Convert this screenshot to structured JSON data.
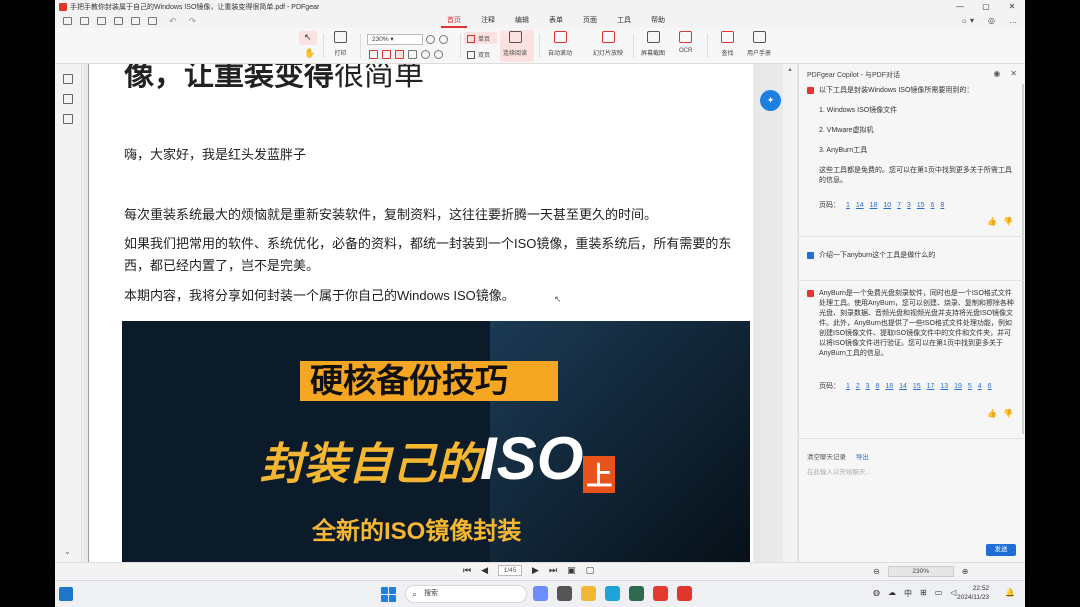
{
  "window": {
    "title": "手把手教你封装属于自己的Windows ISO镜像，让重装变得很简单.pdf - PDFgear",
    "controls": [
      "—",
      "▢",
      "✕"
    ]
  },
  "menu_tabs": [
    "首页",
    "注释",
    "编辑",
    "表单",
    "页面",
    "工具",
    "帮助"
  ],
  "active_menu_tab": "首页",
  "ribbon": {
    "print": "打印",
    "zoom_value": "230%",
    "single_page": "单页",
    "double_page": "双页",
    "continuous": "连续阅读",
    "auto_scroll": "自动滚动",
    "slideshow": "幻灯片放映",
    "screenshot": "屏幕截图",
    "ocr": "OCR",
    "find": "查找",
    "manual": "用户手册"
  },
  "document": {
    "heading_bold": "像，让重装变得",
    "heading_light": "很简单",
    "paragraphs": [
      "嗨，大家好，我是红头发蓝胖子",
      "每次重装系统最大的烦恼就是重新安装软件，复制资料，这往往要折腾一天甚至更久的时间。",
      "如果我们把常用的软件、系统优化，必备的资料，都统一封装到一个ISO镜像，重装系统后，所有需要的东西，都已经内置了，岂不是完美。",
      "本期内容，我将分享如何封装一个属于你自己的Windows ISO镜像。"
    ],
    "banner": {
      "line1": "硬核备份技巧",
      "line2_prefix": "封装自己的",
      "line2_iso": "ISO",
      "line2_badge": "上",
      "line3": "全新的ISO镜像封装"
    }
  },
  "copilot": {
    "header": "PDFgear Copilot - 与PDF对话",
    "answer1": {
      "intro": "以下工具是封装Windows ISO镜像所需要用到的：",
      "items": [
        "1. Windows ISO镜像文件",
        "2. VMware虚拟机",
        "3. AnyBurn工具"
      ],
      "note": "这些工具都是免费的。您可以在第1页中找到更多关于所需工具的信息。",
      "pages_label": "页码：",
      "pages": [
        "1",
        "14",
        "18",
        "10",
        "7",
        "3",
        "15",
        "6",
        "8"
      ]
    },
    "question": "介绍一下anyburn这个工具是做什么的",
    "answer2": {
      "text": "AnyBurn是一个免费光盘刻录软件，同时也是一个ISO格式文件处理工具。使用AnyBurn，您可以创建、烧录、复制和擦除各种光盘、刻录数据、音频光盘和视频光盘并支持将光盘ISO镜像文件。此外，AnyBurn也提供了一些ISO格式文件处理功能，例如创建ISO镜像文件、提取ISO镜像文件中的文件和文件夹，并可以将ISO镜像文件进行验证。您可以在第1页中找到更多关于AnyBurn工具的信息。",
      "pages_label": "页码：",
      "pages": [
        "1",
        "2",
        "3",
        "8",
        "18",
        "14",
        "15",
        "17",
        "13",
        "19",
        "5",
        "4",
        "6"
      ]
    },
    "clear_history": "清空聊天记录",
    "export": "导出",
    "input_placeholder": "在此输入以开始聊天...",
    "send": "发送"
  },
  "statusbar": {
    "page_indicator": "1/45",
    "zoom": "230%"
  },
  "taskbar": {
    "search_label": "搜索",
    "ime": "中",
    "time": "22:52",
    "date": "2024/11/23"
  }
}
